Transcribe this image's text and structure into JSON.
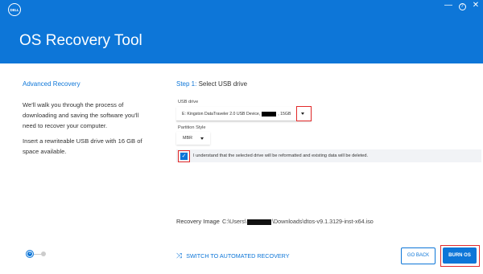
{
  "window": {
    "logo_text": "DELL",
    "minimize_glyph": "—",
    "help_glyph": "?",
    "close_glyph": "✕"
  },
  "header": {
    "title": "OS Recovery Tool"
  },
  "left_panel": {
    "title": "Advanced Recovery",
    "paragraph1": "We'll walk you through the process of downloading and saving the software you'll need to recover your computer.",
    "paragraph2": "Insert a rewriteable USB drive with 16 GB of space available."
  },
  "step": {
    "prefix": "Step 1:",
    "title": "Select USB drive"
  },
  "usb_drive": {
    "label": "USB drive",
    "value_prefix": "E: Kingston DataTraveler 2.0 USB Device,",
    "value_suffix": ", 15GB"
  },
  "partition_style": {
    "label": "Partition Style",
    "value": "MBR"
  },
  "acknowledge": {
    "checked": true,
    "text": "I understand that the selected drive will be reformatted and existing data will be deleted."
  },
  "recovery_image": {
    "label": "Recovery Image",
    "path_prefix": "C:\\Users\\",
    "path_suffix": "\\Downloads\\dtos-v9.1.3129-inst-x64.iso"
  },
  "progress": {
    "current_step": "1",
    "total_steps": 2
  },
  "footer": {
    "switch_label": "SWITCH TO AUTOMATED RECOVERY",
    "go_back_label": "GO BACK",
    "burn_label": "BURN OS"
  },
  "colors": {
    "accent": "#0d76d8",
    "highlight_box": "#e32a2a"
  },
  "icons": {
    "switch": "shuffle-icon",
    "dropdown": "caret-down-icon",
    "check": "checkmark-icon"
  }
}
